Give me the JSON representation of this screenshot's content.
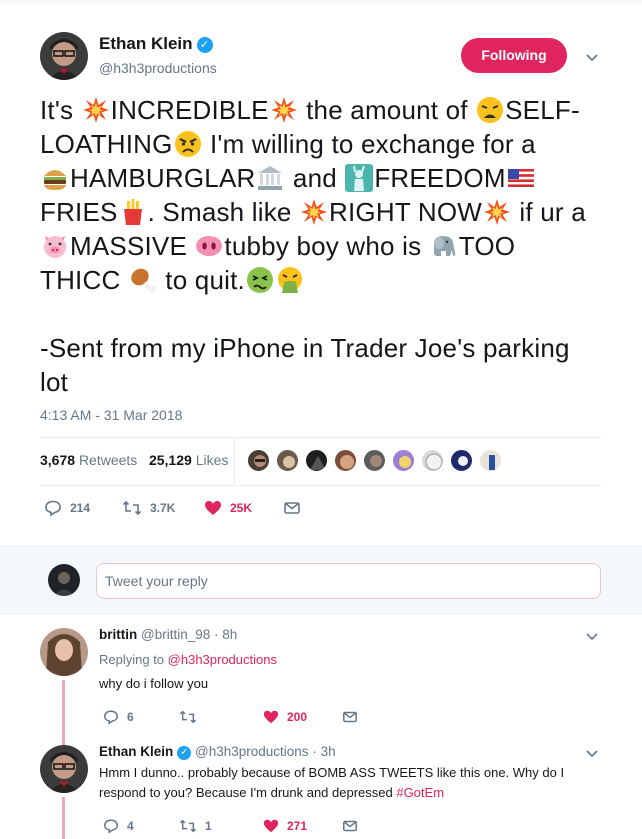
{
  "tweet": {
    "author_name": "Ethan Klein",
    "author_handle": "@h3h3productions",
    "follow_label": "Following",
    "lines": [
      [
        "It's ",
        "[explosion]",
        "INCREDIBLE",
        "[explosion]",
        " the amount of ",
        "[weary]",
        "SELF-"
      ],
      [
        "LOATHING",
        "[angry]",
        " I'm willing to exchange for a"
      ],
      [
        "[burger]",
        "HAMBURGLAR",
        "[bank]",
        " and ",
        "[liberty]",
        "FREEDOM",
        "[us-flag]"
      ],
      [
        "FRIES",
        "[fries]",
        ". Smash like ",
        "[explosion]",
        "RIGHT NOW",
        "[explosion]",
        " if ur a"
      ],
      [
        "[pig]",
        "MASSIVE ",
        "[pig-nose]",
        "tubby boy who is ",
        "[elephant]",
        "TOO"
      ],
      [
        "THICC ",
        "[drumstick]",
        " to quit.",
        "[nauseated]",
        "[vomit]"
      ]
    ],
    "signature_lines": [
      "-Sent from my iPhone in Trader Joe's parking",
      "lot"
    ],
    "timestamp": "4:13 AM - 31 Mar 2018",
    "retweets_count": "3,678",
    "retweets_label": "Retweets",
    "likes_count": "25,129",
    "likes_label": "Likes",
    "replies_short": "214",
    "retweets_short": "3.7K",
    "likes_short": "25K",
    "icons": {
      "reply": "reply-icon",
      "retweet": "retweet-icon",
      "like": "heart-icon",
      "dm": "envelope-icon"
    }
  },
  "composer": {
    "placeholder": "Tweet your reply"
  },
  "replies": [
    {
      "name": "brittin",
      "handle": "@brittin_98",
      "time": "· 8h",
      "replying_prefix": "Replying to ",
      "replying_to": "@h3h3productions",
      "text": "why do i follow you",
      "reply_count": "6",
      "retweet_count": "",
      "like_count": "200"
    },
    {
      "name": "Ethan Klein",
      "handle": "@h3h3productions",
      "time": "· 3h",
      "text_line1": "Hmm I dunno.. probably because of BOMB ASS TWEETS like this one. Why do I",
      "text_line2": "respond to you? Because I'm drunk and depressed ",
      "hashtag": "#GotEm",
      "reply_count": "4",
      "retweet_count": "1",
      "like_count": "271"
    }
  ],
  "colors": {
    "accent": "#e0245e",
    "verified": "#1da1f2",
    "muted": "#657786",
    "text": "#14171a"
  }
}
